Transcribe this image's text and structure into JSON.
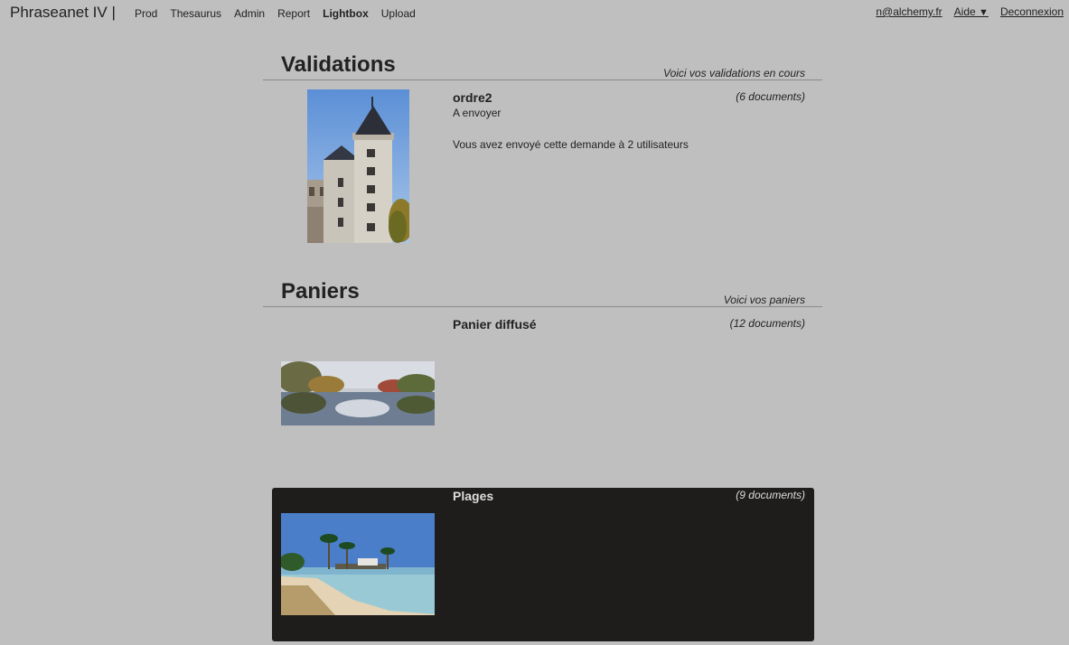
{
  "app": {
    "title": "Phraseanet IV |"
  },
  "nav": {
    "items": [
      {
        "label": "Prod"
      },
      {
        "label": "Thesaurus"
      },
      {
        "label": "Admin"
      },
      {
        "label": "Report"
      },
      {
        "label": "Lightbox"
      },
      {
        "label": "Upload"
      }
    ],
    "active": "Lightbox"
  },
  "user": {
    "email": "n@alchemy.fr",
    "help_label": "Aide",
    "help_caret": "▼",
    "logout_label": "Deconnexion"
  },
  "validations": {
    "title": "Validations",
    "subtitle": "Voici vos validations en cours",
    "items": [
      {
        "name": "ordre2",
        "count": "(6 documents)",
        "status": "A envoyer",
        "description": "Vous avez envoyé cette demande à 2 utilisateurs"
      }
    ]
  },
  "baskets": {
    "title": "Paniers",
    "subtitle": "Voici vos paniers",
    "items": [
      {
        "name": "Panier diffusé",
        "count": "(12 documents)"
      },
      {
        "name": "Plages",
        "count": "(9 documents)"
      }
    ]
  },
  "colors": {
    "background": "#bfbfbf",
    "selected_panel": "#1f1d1b"
  }
}
